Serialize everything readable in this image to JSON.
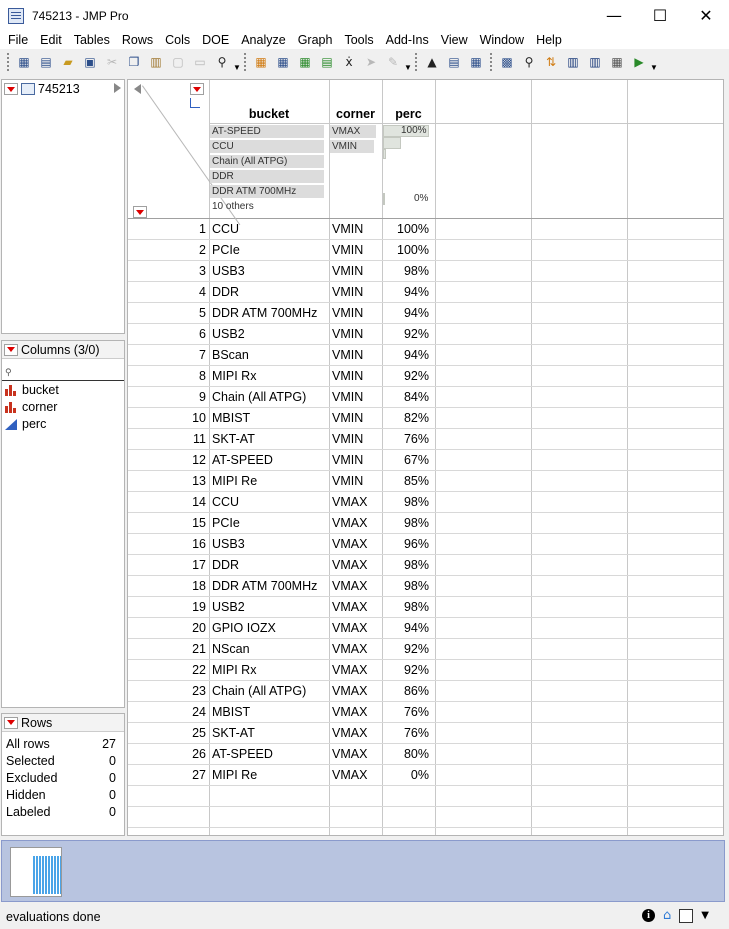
{
  "window": {
    "title": "745213 - JMP Pro",
    "minimize": "—",
    "maximize": "☐",
    "close": "✕"
  },
  "menu": [
    "File",
    "Edit",
    "Tables",
    "Rows",
    "Cols",
    "DOE",
    "Analyze",
    "Graph",
    "Tools",
    "Add-Ins",
    "View",
    "Window",
    "Help"
  ],
  "table_panel": {
    "name": "745213"
  },
  "columns_panel": {
    "header": "Columns (3/0)",
    "items": [
      {
        "name": "bucket",
        "icon": "nominal-bar-icon"
      },
      {
        "name": "corner",
        "icon": "nominal-bar-icon"
      },
      {
        "name": "perc",
        "icon": "continuous-triangle-icon"
      }
    ]
  },
  "rows_panel": {
    "header": "Rows",
    "items": [
      {
        "label": "All rows",
        "value": "27"
      },
      {
        "label": "Selected",
        "value": "0"
      },
      {
        "label": "Excluded",
        "value": "0"
      },
      {
        "label": "Hidden",
        "value": "0"
      },
      {
        "label": "Labeled",
        "value": "0"
      }
    ]
  },
  "grid": {
    "columns": [
      "bucket",
      "corner",
      "perc"
    ],
    "bucket_levels": [
      "AT-SPEED",
      "CCU",
      "Chain (All ATPG)",
      "DDR",
      "DDR ATM 700MHz",
      "10 others"
    ],
    "corner_levels": [
      "VMAX",
      "VMIN"
    ],
    "perc_max_label": "100%",
    "perc_min_label": "0%",
    "rows": [
      {
        "n": "1",
        "bucket": "CCU",
        "corner": "VMIN",
        "perc": "100%"
      },
      {
        "n": "2",
        "bucket": "PCIe",
        "corner": "VMIN",
        "perc": "100%"
      },
      {
        "n": "3",
        "bucket": "USB3",
        "corner": "VMIN",
        "perc": "98%"
      },
      {
        "n": "4",
        "bucket": "DDR",
        "corner": "VMIN",
        "perc": "94%"
      },
      {
        "n": "5",
        "bucket": "DDR ATM 700MHz",
        "corner": "VMIN",
        "perc": "94%"
      },
      {
        "n": "6",
        "bucket": "USB2",
        "corner": "VMIN",
        "perc": "92%"
      },
      {
        "n": "7",
        "bucket": "BScan",
        "corner": "VMIN",
        "perc": "94%"
      },
      {
        "n": "8",
        "bucket": "MIPI Rx",
        "corner": "VMIN",
        "perc": "92%"
      },
      {
        "n": "9",
        "bucket": "Chain (All ATPG)",
        "corner": "VMIN",
        "perc": "84%"
      },
      {
        "n": "10",
        "bucket": "MBIST",
        "corner": "VMIN",
        "perc": "82%"
      },
      {
        "n": "11",
        "bucket": "SKT-AT",
        "corner": "VMIN",
        "perc": "76%"
      },
      {
        "n": "12",
        "bucket": "AT-SPEED",
        "corner": "VMIN",
        "perc": "67%"
      },
      {
        "n": "13",
        "bucket": "MIPI Re",
        "corner": "VMIN",
        "perc": "85%"
      },
      {
        "n": "14",
        "bucket": "CCU",
        "corner": "VMAX",
        "perc": "98%"
      },
      {
        "n": "15",
        "bucket": "PCIe",
        "corner": "VMAX",
        "perc": "98%"
      },
      {
        "n": "16",
        "bucket": "USB3",
        "corner": "VMAX",
        "perc": "96%"
      },
      {
        "n": "17",
        "bucket": "DDR",
        "corner": "VMAX",
        "perc": "98%"
      },
      {
        "n": "18",
        "bucket": "DDR ATM 700MHz",
        "corner": "VMAX",
        "perc": "98%"
      },
      {
        "n": "19",
        "bucket": "USB2",
        "corner": "VMAX",
        "perc": "98%"
      },
      {
        "n": "20",
        "bucket": "GPIO IOZX",
        "corner": "VMAX",
        "perc": "94%"
      },
      {
        "n": "21",
        "bucket": "NScan",
        "corner": "VMAX",
        "perc": "92%"
      },
      {
        "n": "22",
        "bucket": "MIPI Rx",
        "corner": "VMAX",
        "perc": "92%"
      },
      {
        "n": "23",
        "bucket": "Chain (All ATPG)",
        "corner": "VMAX",
        "perc": "86%"
      },
      {
        "n": "24",
        "bucket": "MBIST",
        "corner": "VMAX",
        "perc": "76%"
      },
      {
        "n": "25",
        "bucket": "SKT-AT",
        "corner": "VMAX",
        "perc": "76%"
      },
      {
        "n": "26",
        "bucket": "AT-SPEED",
        "corner": "VMAX",
        "perc": "80%"
      },
      {
        "n": "27",
        "bucket": "MIPI Re",
        "corner": "VMAX",
        "perc": "0%"
      }
    ]
  },
  "status": {
    "text": "evaluations done"
  },
  "colors": {
    "thumbnail_bg": "#b8c4e0",
    "red_triangle": "#dd0000",
    "continuous_icon": "#3060c0",
    "nominal_icon": "#c8321e"
  }
}
